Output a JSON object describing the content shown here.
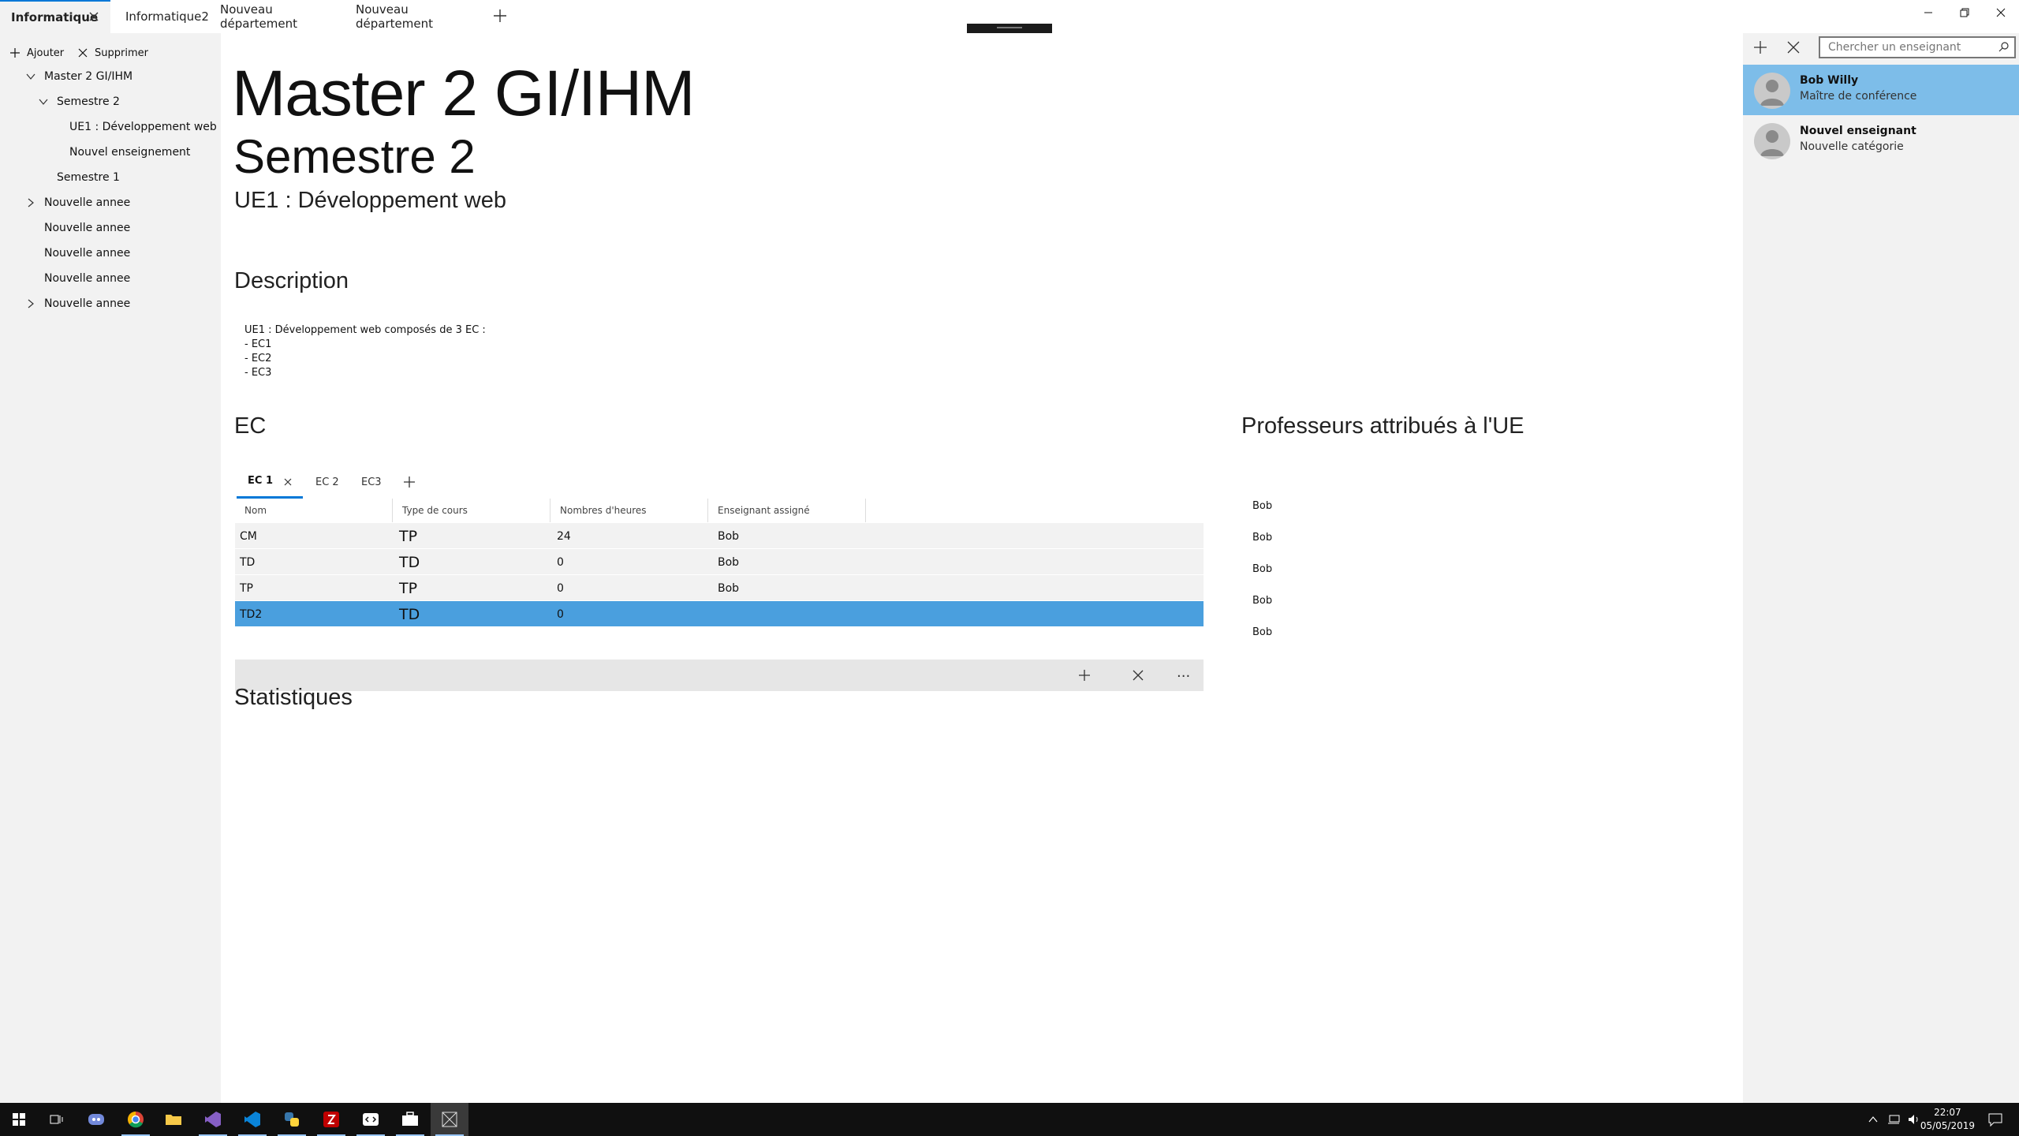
{
  "tabs": [
    {
      "label": "Informatique"
    },
    {
      "label": "Informatique2"
    },
    {
      "label": "Nouveau département"
    },
    {
      "label": "Nouveau département"
    }
  ],
  "left": {
    "add_label": "Ajouter",
    "delete_label": "Supprimer",
    "tree": [
      {
        "label": "Master 2 GI/IHM"
      },
      {
        "label": "Semestre 2"
      },
      {
        "label": "UE1 : Développement web"
      },
      {
        "label": "Nouvel enseignement"
      },
      {
        "label": "Semestre 1"
      },
      {
        "label": "Nouvelle annee"
      },
      {
        "label": "Nouvelle annee"
      },
      {
        "label": "Nouvelle annee"
      },
      {
        "label": "Nouvelle annee"
      },
      {
        "label": "Nouvelle annee"
      }
    ]
  },
  "main": {
    "title": "Master 2 GI/IHM",
    "semester": "Semestre 2",
    "ue": "UE1 : Développement web",
    "description_title": "Description",
    "description": "UE1 : Développement web composés de 3 EC :\n- EC1\n- EC2\n- EC3",
    "ec_title": "EC",
    "ec_tabs": [
      {
        "label": "EC 1"
      },
      {
        "label": "EC 2"
      },
      {
        "label": "EC3"
      }
    ],
    "grid": {
      "headers": [
        "Nom",
        "Type de cours",
        "Nombres d'heures",
        "Enseignant assigné"
      ],
      "rows": [
        {
          "nom": "CM",
          "type": "TP",
          "heures": "24",
          "enseignant": "Bob"
        },
        {
          "nom": "TD",
          "type": "TD",
          "heures": "0",
          "enseignant": "Bob"
        },
        {
          "nom": "TP",
          "type": "TP",
          "heures": "0",
          "enseignant": "Bob"
        },
        {
          "nom": "TD2",
          "type": "TD",
          "heures": "0",
          "enseignant": ""
        }
      ],
      "more_label": "..."
    },
    "prof_title": "Professeurs attribués à l'UE",
    "profs": [
      "Bob",
      "Bob",
      "Bob",
      "Bob",
      "Bob"
    ],
    "stats_title": "Statistiques"
  },
  "right": {
    "search_placeholder": "Chercher un enseignant",
    "teachers": [
      {
        "name": "Bob Willy",
        "role": "Maître de conférence"
      },
      {
        "name": "Nouvel enseignant",
        "role": "Nouvelle catégorie"
      }
    ]
  },
  "taskbar": {
    "time": "22:07",
    "date": "05/05/2019",
    "icons": [
      "windows-start-icon",
      "task-view-icon",
      "discord-icon",
      "chrome-icon",
      "file-explorer-icon",
      "visual-studio-icon",
      "vscode-icon",
      "python-icon",
      "filezilla-icon",
      "code-editor-icon",
      "briefcase-icon",
      "app-icon"
    ]
  },
  "colors": {
    "accent": "#0078d7",
    "selected_row": "#4a9fde",
    "selected_teacher": "#7dbde9",
    "pane_bg": "#f2f2f2"
  }
}
